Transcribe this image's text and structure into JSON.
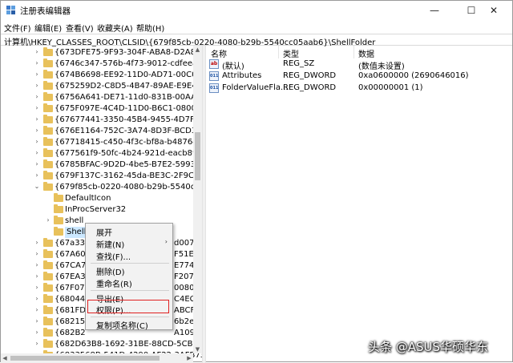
{
  "window": {
    "title": "注册表编辑器",
    "controls": {
      "minimize": "—",
      "maximize": "☐",
      "close": "✕"
    }
  },
  "menu": [
    "文件(F)",
    "编辑(E)",
    "查看(V)",
    "收藏夹(A)",
    "帮助(H)"
  ],
  "address": "计算机\\HKEY_CLASSES_ROOT\\CLSID\\{679f85cb-0220-4080-b29b-5540cc05aab6}\\ShellFolder",
  "tree": {
    "rows": [
      {
        "label": "{673DFE75-9F93-304F-ABA8-D2A86BA",
        "expanded": false
      },
      {
        "label": "{6746c347-576b-4f73-9012-cdfeea251",
        "expanded": false
      },
      {
        "label": "{674B6698-EE92-11D0-AD71-00C04FD8",
        "expanded": false
      },
      {
        "label": "{675259D2-C8D5-4B47-89AE-E9E44C0",
        "expanded": false
      },
      {
        "label": "{6756A641-DE71-11d0-831B-00AA005",
        "expanded": false
      },
      {
        "label": "{675F097E-4C4D-11D0-B6C1-0800091A",
        "expanded": false
      },
      {
        "label": "{67677441-3350-45B4-9455-4D7F4A50",
        "expanded": false
      },
      {
        "label": "{676E1164-752C-3A74-8D3F-BCD32A2",
        "expanded": false
      },
      {
        "label": "{67718415-c450-4f3c-bf8a-b487642dc",
        "expanded": false
      },
      {
        "label": "{677561f9-50fc-4b24-921d-eacb89706",
        "expanded": false
      },
      {
        "label": "{6785BFAC-9D2D-4be5-B7E2-59937E8I",
        "expanded": false
      },
      {
        "label": "{679F137C-3162-45da-BE3C-2F9C3D09",
        "expanded": false
      },
      {
        "label": "{679f85cb-0220-4080-b29b-5540cc05a",
        "expanded": true
      }
    ],
    "children": [
      {
        "label": "DefaultIcon"
      },
      {
        "label": "InProcServer32"
      },
      {
        "label": "shell",
        "expandable": true
      },
      {
        "label": "ShellFolder",
        "selected": true
      }
    ],
    "after_rows": [
      {
        "label": "{67a33"
      },
      {
        "label": "{67A60"
      },
      {
        "label": "{67CA7"
      },
      {
        "label": "{67EA3"
      },
      {
        "label": "{67F07"
      },
      {
        "label": "{68044"
      },
      {
        "label": "{681FD"
      },
      {
        "label": "{68215"
      },
      {
        "label": "{682B2"
      },
      {
        "label": "{682D63B8-1692-31BE-88CD-5CB1F79E"
      },
      {
        "label": "{6833568B-541D-4290-AF22-3AFB73D"
      }
    ],
    "after_tails": [
      "d007c",
      "F51EA",
      "E774F",
      "F207D",
      "00803",
      "C4EC",
      "ABCFE",
      "6b2ec",
      "A109"
    ]
  },
  "values_pane": {
    "headers": {
      "name": "名称",
      "type": "类型",
      "data": "数据"
    },
    "rows": [
      {
        "icon": "ab",
        "name": "(默认)",
        "type": "REG_SZ",
        "data": "(数值未设置)"
      },
      {
        "icon": "bin",
        "name": "Attributes",
        "type": "REG_DWORD",
        "data": "0xa0600000 (2690646016)"
      },
      {
        "icon": "bin",
        "name": "FolderValueFla...",
        "type": "REG_DWORD",
        "data": "0x00000001 (1)"
      }
    ]
  },
  "context_menu": {
    "items": [
      {
        "label": "展开"
      },
      {
        "label": "新建(N)",
        "submenu": true
      },
      {
        "label": "查找(F)..."
      },
      {
        "label": "删除(D)"
      },
      {
        "label": "重命名(R)"
      },
      {
        "label": "导出(E)"
      },
      {
        "label": "权限(P)...",
        "highlighted": true
      },
      {
        "label": "复制项名称(C)"
      }
    ]
  },
  "watermark": "头条 @ASUS华硕华东",
  "colors": {
    "selection": "#cce8ff",
    "highlight_box": "#e02020",
    "folder": "#e8c15b"
  }
}
